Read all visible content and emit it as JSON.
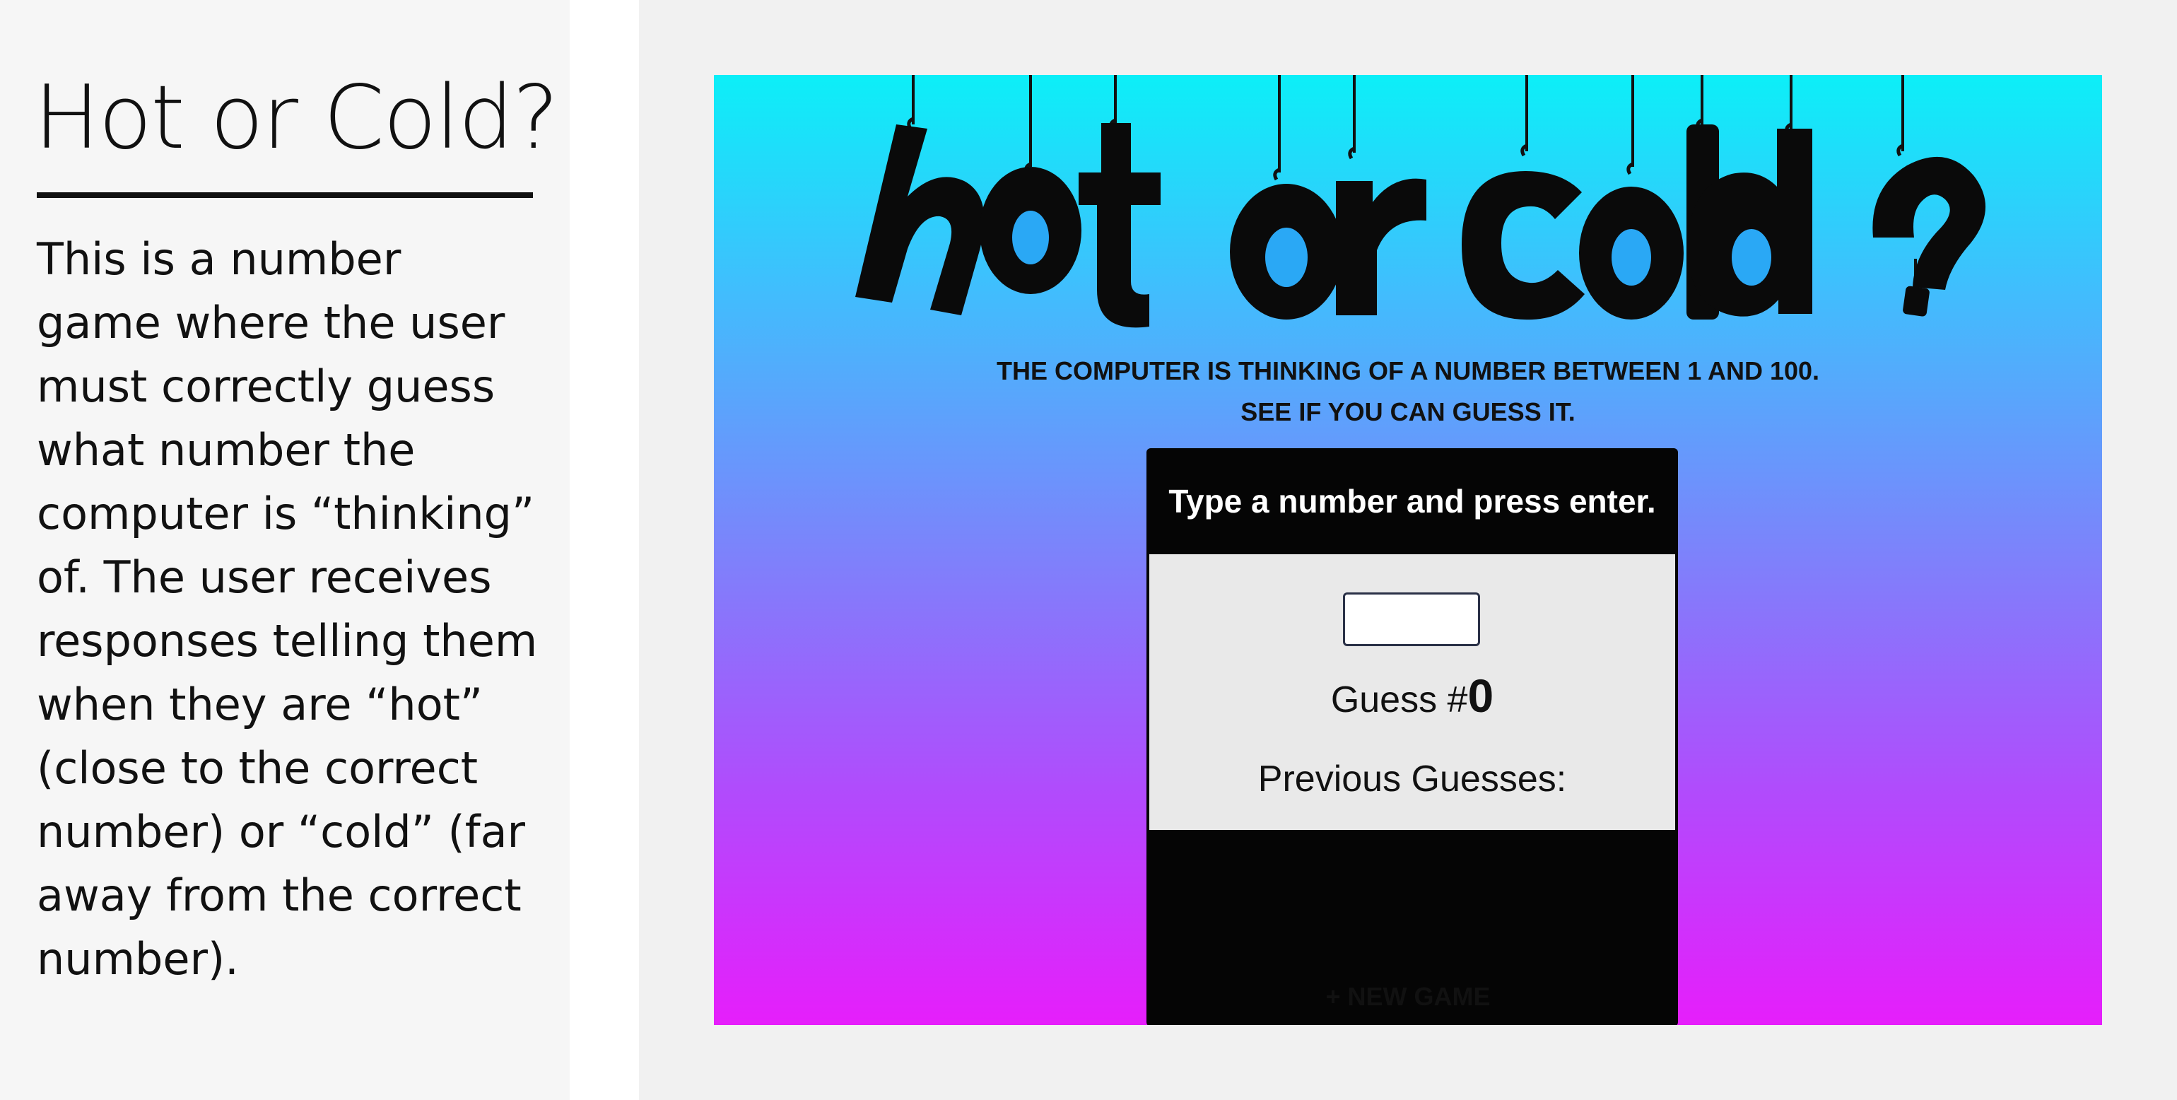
{
  "sidebar": {
    "title": "Hot or Cold?",
    "description": "This is a number game where the user must correctly guess what number the computer is “thinking” of. The user receives responses telling them when they are “hot” (close to the correct number) or “cold” (far away from the correct number)."
  },
  "game": {
    "logo_text": "hot or cold?",
    "instructions_line1": "THE COMPUTER IS THINKING OF A NUMBER BETWEEN 1 AND 100.",
    "instructions_line2": "SEE IF YOU CAN GUESS IT.",
    "feedback": "Type a number and press enter.",
    "guess_input_value": "",
    "guess_label": "Guess #",
    "guess_count": "0",
    "previous_guesses_label": "Previous Guesses:",
    "previous_guesses": [],
    "new_game_label": "+ NEW GAME"
  },
  "colors": {
    "gradient_top": "#0ceff8",
    "gradient_bottom": "#e61efb",
    "box_background": "#050505",
    "form_background": "#e9e9e9"
  }
}
